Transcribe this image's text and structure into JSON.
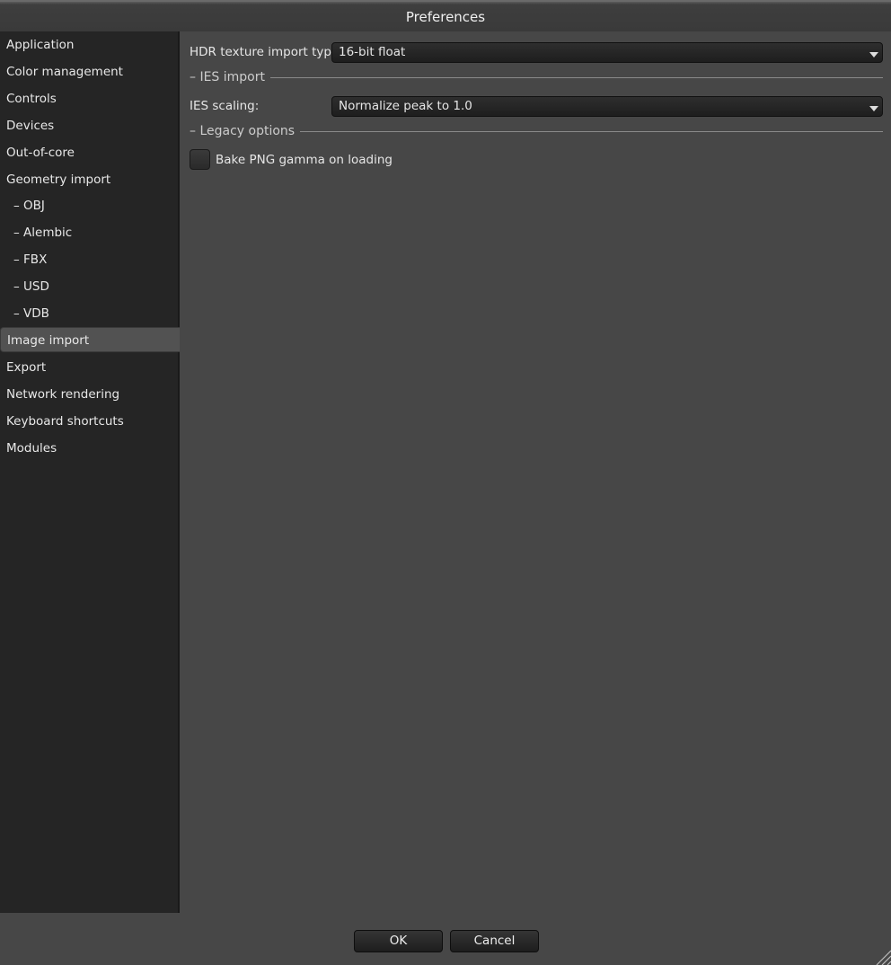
{
  "window": {
    "title": "Preferences"
  },
  "sidebar": {
    "items": [
      {
        "label": "Application"
      },
      {
        "label": "Color management"
      },
      {
        "label": "Controls"
      },
      {
        "label": "Devices"
      },
      {
        "label": "Out-of-core"
      },
      {
        "label": "Geometry import"
      },
      {
        "label": "–  OBJ"
      },
      {
        "label": "–  Alembic"
      },
      {
        "label": "–  FBX"
      },
      {
        "label": "–  USD"
      },
      {
        "label": "–  VDB"
      },
      {
        "label": "Image import",
        "selected": true
      },
      {
        "label": "Export"
      },
      {
        "label": "Network rendering"
      },
      {
        "label": "Keyboard shortcuts"
      },
      {
        "label": "Modules"
      }
    ]
  },
  "content": {
    "hdr_label": "HDR texture import type:",
    "hdr_value": "16-bit float",
    "ies_group": "– IES import",
    "ies_label": "IES scaling:",
    "ies_value": "Normalize peak to 1.0",
    "legacy_group": "– Legacy options",
    "bake_label": "Bake PNG gamma on loading",
    "bake_checked": false
  },
  "footer": {
    "ok": "OK",
    "cancel": "Cancel"
  }
}
